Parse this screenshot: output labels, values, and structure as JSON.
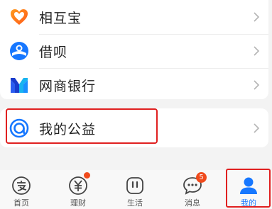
{
  "menu": {
    "items": [
      {
        "label": "相互宝",
        "icon": "heart-logo-icon"
      },
      {
        "label": "借呗",
        "icon": "jiebei-logo-icon"
      },
      {
        "label": "网商银行",
        "icon": "mybank-logo-icon"
      }
    ],
    "charity": {
      "label": "我的公益",
      "icon": "charity-logo-icon"
    }
  },
  "tabbar": {
    "tabs": [
      {
        "label": "首页",
        "icon": "alipay-home-icon"
      },
      {
        "label": "理财",
        "icon": "yuan-icon",
        "has_dot": true
      },
      {
        "label": "生活",
        "icon": "life-icon"
      },
      {
        "label": "消息",
        "icon": "message-icon",
        "badge": "5"
      },
      {
        "label": "我的",
        "icon": "profile-icon",
        "active": true
      }
    ]
  },
  "colors": {
    "accent": "#1677ff",
    "highlight": "#e02020",
    "badge": "#f04a1c",
    "heart": "#ff6a00"
  }
}
